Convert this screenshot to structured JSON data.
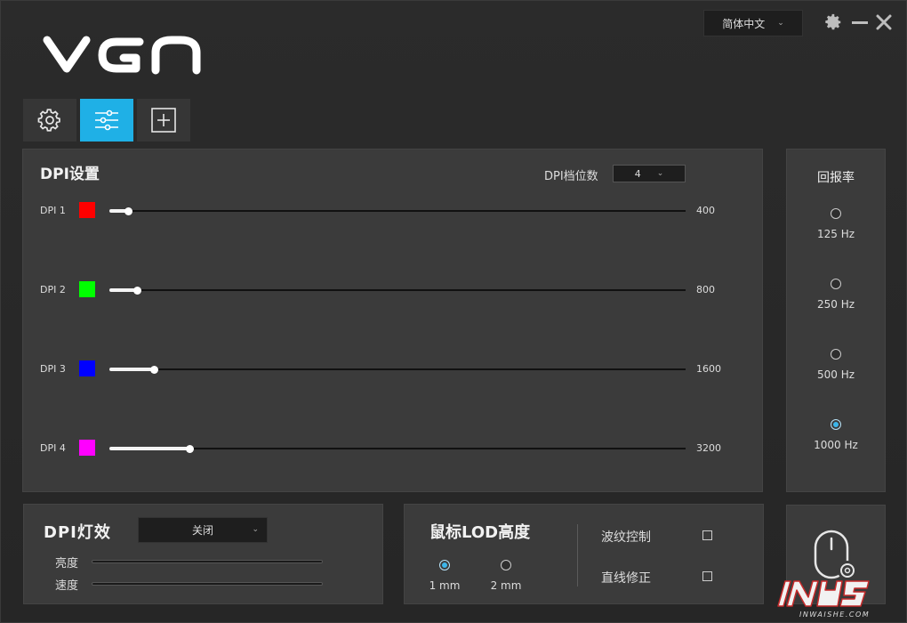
{
  "header": {
    "logo_text": "VGN",
    "language": "简体中文"
  },
  "dpi": {
    "title": "DPI设置",
    "count_label": "DPI档位数",
    "count_value": "4",
    "rows": [
      {
        "label": "DPI 1",
        "color": "#ff0000",
        "value": "400",
        "level": 0.02
      },
      {
        "label": "DPI 2",
        "color": "#00ff00",
        "value": "800",
        "level": 0.035
      },
      {
        "label": "DPI 3",
        "color": "#0000ff",
        "value": "1600",
        "level": 0.065
      },
      {
        "label": "DPI 4",
        "color": "#ff00ff",
        "value": "3200",
        "level": 0.126
      }
    ]
  },
  "polling": {
    "title": "回报率",
    "options": [
      {
        "label": "125 Hz",
        "selected": false
      },
      {
        "label": "250 Hz",
        "selected": false
      },
      {
        "label": "500 Hz",
        "selected": false
      },
      {
        "label": "1000 Hz",
        "selected": true
      }
    ]
  },
  "light": {
    "title": "DPI灯效",
    "effect": "关闭",
    "brightness_label": "亮度",
    "speed_label": "速度"
  },
  "lod": {
    "title": "鼠标LOD高度",
    "options": [
      {
        "label": "1 mm",
        "selected": true
      },
      {
        "label": "2 mm",
        "selected": false
      }
    ],
    "ripple_label": "波纹控制",
    "angle_snap_label": "直线修正"
  },
  "colors": {
    "accent": "#1fb0e6"
  },
  "watermark": {
    "text": "INWAISHE.COM"
  }
}
